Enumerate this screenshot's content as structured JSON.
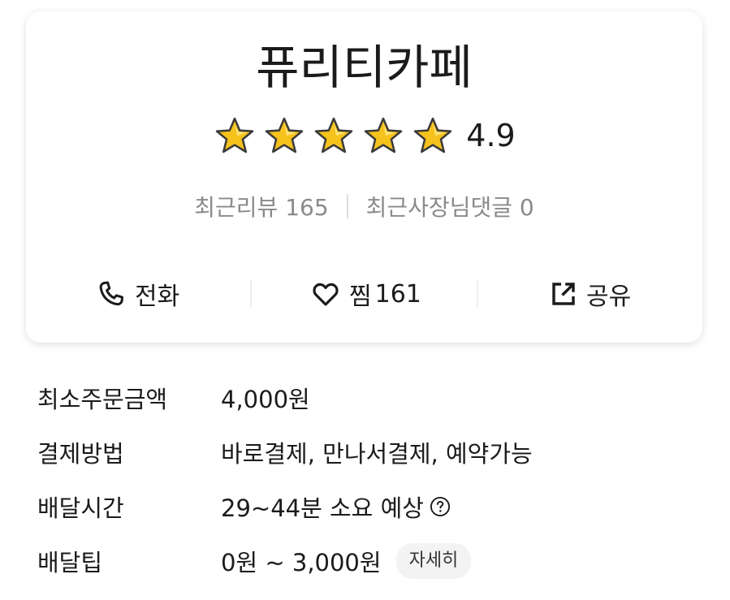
{
  "store": {
    "name": "퓨리티카페",
    "rating": "4.9",
    "stars_filled": 5,
    "stars_total": 5,
    "recent_reviews": "최근리뷰 165",
    "recent_owner_comments": "최근사장님댓글 0"
  },
  "actions": {
    "call_label": "전화",
    "favorite_label": "찜",
    "favorite_count": "161",
    "share_label": "공유"
  },
  "info": [
    {
      "label": "최소주문금액",
      "value": "4,000원"
    },
    {
      "label": "결제방법",
      "value": "바로결제, 만나서결제, 예약가능"
    },
    {
      "label": "배달시간",
      "value": "29~44분 소요 예상"
    },
    {
      "label": "배달팁",
      "value": "0원 ~ 3,000원",
      "button": "자세히"
    }
  ],
  "icons": {
    "star": "star-icon",
    "call": "phone-icon",
    "favorite": "heart-icon",
    "share": "share-icon",
    "help": "question-circle-icon"
  },
  "colors": {
    "star_fill": "#f6c21c",
    "star_outline": "#3a3a3a",
    "text_primary": "#1b1b1b",
    "text_secondary": "#8a8a8a",
    "detail_button_bg": "#f3f3f3"
  }
}
